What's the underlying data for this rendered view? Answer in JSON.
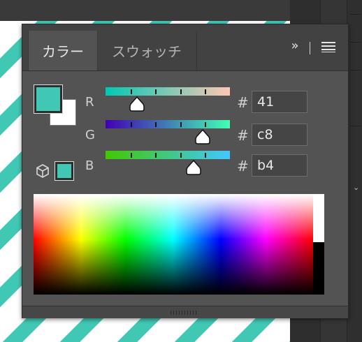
{
  "tabs": [
    {
      "label": "カラー",
      "active": true
    },
    {
      "label": "スウォッチ",
      "active": false
    }
  ],
  "colors": {
    "foreground": "#41c8b4",
    "background": "#ffffff",
    "websafe": "#41c8b4"
  },
  "channels": [
    {
      "label": "R",
      "hash": "#",
      "value": "41",
      "level": 0.25,
      "gradient": [
        "#00c8b4",
        "#ffc8b4"
      ]
    },
    {
      "label": "G",
      "hash": "#",
      "value": "c8",
      "level": 0.78,
      "gradient": [
        "#4100b4",
        "#41ffb4"
      ]
    },
    {
      "label": "B",
      "hash": "#",
      "value": "b4",
      "level": 0.71,
      "gradient": [
        "#41c800",
        "#41c8ff"
      ]
    }
  ],
  "icons": {
    "expand": "double-chevron-right-icon",
    "menu": "hamburger-menu-icon",
    "websafe_warning": "cube-icon",
    "side_arrow": "chevron-down-icon"
  }
}
